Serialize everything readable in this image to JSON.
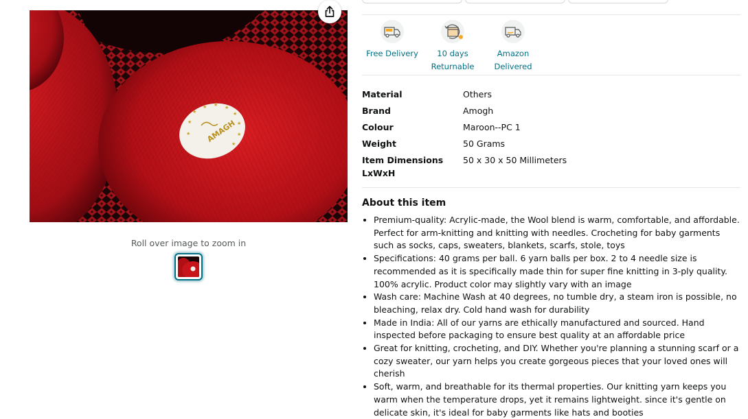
{
  "gallery": {
    "share_icon": "share-icon",
    "zoom_hint": "Roll over image to zoom in",
    "label_text": "AMAGH"
  },
  "features": [
    {
      "icon": "free-delivery-icon",
      "label": "Free Delivery"
    },
    {
      "icon": "returnable-icon",
      "label": "10 days\nReturnable"
    },
    {
      "icon": "amazon-delivered-icon",
      "label": "Amazon\nDelivered"
    }
  ],
  "specs": [
    {
      "key": "Material",
      "value": "Others"
    },
    {
      "key": "Brand",
      "value": "Amogh"
    },
    {
      "key": "Colour",
      "value": "Maroon--PC 1"
    },
    {
      "key": "Weight",
      "value": "50 Grams"
    },
    {
      "key": "Item Dimensions LxWxH",
      "value": "50 x 30 x 50 Millimeters"
    }
  ],
  "about": {
    "title": "About this item",
    "bullets": [
      "Premium-quality: Acrylic-made, the Wool blend is warm, comfortable, and affordable. Perfect for arm-knitting and knitting with needles. Crocheting for baby garments such as socks, caps, sweaters, blankets, scarfs, stole, toys",
      "Specifications: 40 grams per ball. 6 yarn balls per box. 2 to 4 needle size is recommended as it is specifically made thin for super fine knitting in 3-ply quality. 100% acrylic. Product color may slightly vary with an image",
      "Wash care: Machine Wash at 40 degrees, no tumble dry, a steam iron is possible, no bleaching, relax dry. Cold hand wash for durability",
      "Made in India: All of our yarns are ethically manufactured and sourced. Hand inspected before packaging to ensure best quality at an affordable price",
      "Great for knitting, crocheting, and DIY. Whether you're planning a stunning scarf or a cozy sweater, our yarn helps you create gorgeous pieces that your loved ones will cherish",
      "Soft, warm, and breathable for its thermal properties. Our knitting yarn keeps you warm when the temperature drops, yet it remains lightweight. since it's gentle on delicate skin, it's ideal for baby garments like hats and booties"
    ]
  },
  "colors": {
    "link": "#007185",
    "yarn_red": "#c8141b",
    "text": "#0f1111"
  }
}
